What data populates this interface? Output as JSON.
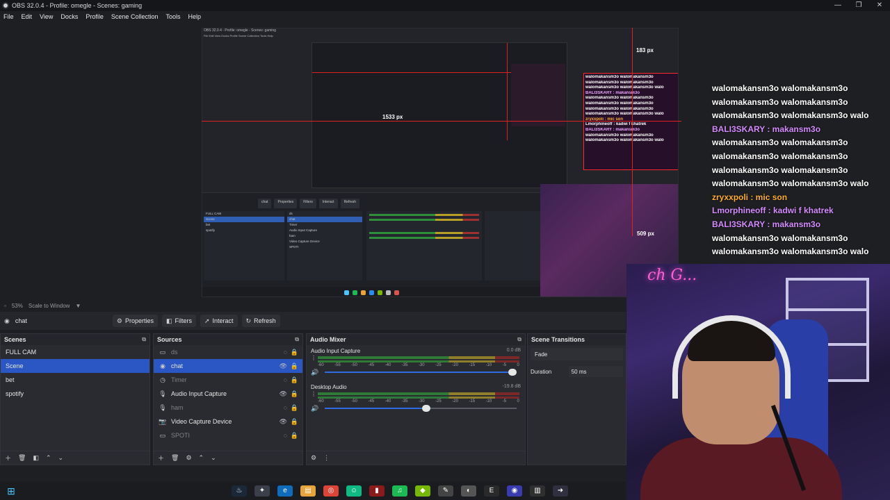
{
  "window": {
    "title": "OBS 32.0.4 - Profile: omegle - Scenes: gaming",
    "controls": [
      "—",
      "❐",
      "✕"
    ]
  },
  "menu": [
    "File",
    "Edit",
    "View",
    "Docks",
    "Profile",
    "Scene Collection",
    "Tools",
    "Help"
  ],
  "preview": {
    "nested_title": "OBS 32.0.4 - Profile: omegle - Scenes: gaming",
    "nested_menu": "File  Edit  View  Docks  Profile  Scene Collection  Tools  Help",
    "px_top": "183 px",
    "px_mid": "1533 px",
    "px_bottom": "509 px",
    "nested_toolbar": [
      "chat",
      "Properties",
      "Filters",
      "Interact",
      "Refresh"
    ],
    "nested_scenes": [
      "FULL CAM",
      "Scene",
      "bet",
      "spotify"
    ],
    "nested_sources": [
      "ds",
      "chat",
      "Timer",
      "Audio Input Capture",
      "ham",
      "Video Capture Device",
      "SPOTI"
    ],
    "nested_chat": [
      {
        "cls": "",
        "t": "walomakansm3o walomakansm3o"
      },
      {
        "cls": "",
        "t": "walomakansm3o walomakansm3o"
      },
      {
        "cls": "",
        "t": "walomakansm3o walomakansm3o walo"
      },
      {
        "cls": "pink",
        "t": "BALI3SKARY : makansm3o"
      },
      {
        "cls": "",
        "t": "walomakansm3o walomakansm3o"
      },
      {
        "cls": "",
        "t": "walomakansm3o walomakansm3o"
      },
      {
        "cls": "",
        "t": "walomakansm3o walomakansm3o"
      },
      {
        "cls": "",
        "t": "walomakansm3o walomakansm3o walo"
      },
      {
        "cls": "ora",
        "t": "zryxxpoli : mic son"
      },
      {
        "cls": "",
        "t": "Lmorphineoff : kadwi f khatrek"
      },
      {
        "cls": "pink",
        "t": "BALI3SKARY : makansm3o"
      },
      {
        "cls": "",
        "t": "walomakansm3o walomakansm3o"
      },
      {
        "cls": "",
        "t": "walomakansm3o walomakansm3o walo"
      }
    ]
  },
  "chat": [
    {
      "cls": "u-white",
      "t": "walomakansm3o walomakansm3o"
    },
    {
      "cls": "u-white",
      "t": "walomakansm3o walomakansm3o"
    },
    {
      "cls": "u-white",
      "t": "walomakansm3o walomakansm3o walo"
    },
    {
      "cls": "u-purple",
      "t": "BALI3SKARY : makansm3o"
    },
    {
      "cls": "u-white",
      "t": "walomakansm3o walomakansm3o"
    },
    {
      "cls": "u-white",
      "t": "walomakansm3o walomakansm3o"
    },
    {
      "cls": "u-white",
      "t": "walomakansm3o walomakansm3o"
    },
    {
      "cls": "u-white",
      "t": "walomakansm3o walomakansm3o walo"
    },
    {
      "cls": "u-orange",
      "t": "zryxxpoli : mic son"
    },
    {
      "cls": "u-purple",
      "t": "Lmorphineoff : kadwi f khatrek"
    },
    {
      "cls": "u-purple",
      "t": "BALI3SKARY : makansm3o"
    },
    {
      "cls": "u-white",
      "t": "walomakansm3o walomakansm3o"
    },
    {
      "cls": "u-white",
      "t": "walomakansm3o walomakansm3o walo"
    }
  ],
  "webcam": {
    "neon": "ch G..."
  },
  "transform_bar": {
    "zoom": "53%",
    "scale_mode": "Scale to Window"
  },
  "source_toolbar": {
    "selected_source": "chat",
    "properties": "Properties",
    "filters": "Filters",
    "interact": "Interact",
    "refresh": "Refresh"
  },
  "scenes": {
    "title": "Scenes",
    "items": [
      "FULL CAM",
      "Scene",
      "bet",
      "spotify"
    ],
    "selected": 1
  },
  "sources": {
    "title": "Sources",
    "items": [
      {
        "icon": "▭",
        "label": "ds",
        "dim": true,
        "eye": "◌",
        "lock": "🔒"
      },
      {
        "icon": "◉",
        "label": "chat",
        "dim": false,
        "eye": "👁",
        "lock": "🔒"
      },
      {
        "icon": "◷",
        "label": "Timer",
        "dim": true,
        "eye": "◌",
        "lock": "🔒"
      },
      {
        "icon": "🎙",
        "label": "Audio Input Capture",
        "dim": false,
        "eye": "👁",
        "lock": "🔒"
      },
      {
        "icon": "🎙",
        "label": "ham",
        "dim": true,
        "eye": "◌",
        "lock": "🔒"
      },
      {
        "icon": "📷",
        "label": "Video Capture Device",
        "dim": false,
        "eye": "👁",
        "lock": "🔒"
      },
      {
        "icon": "▭",
        "label": "SPOTI",
        "dim": true,
        "eye": "◌",
        "lock": "🔒"
      }
    ],
    "selected": 1
  },
  "mixer": {
    "title": "Audio Mixer",
    "scale": [
      "-60",
      "-55",
      "-50",
      "-45",
      "-40",
      "-35",
      "-30",
      "-25",
      "-20",
      "-15",
      "-10",
      "-5",
      "0"
    ],
    "tracks": [
      {
        "name": "Audio Input Capture",
        "db": "0.0 dB",
        "volume": 1.0
      },
      {
        "name": "Desktop Audio",
        "db": "-19.8 dB",
        "volume": 0.55
      }
    ]
  },
  "transitions": {
    "title": "Scene Transitions",
    "type": "Fade",
    "duration_label": "Duration",
    "duration_value": "50 ms"
  },
  "colors": {
    "accent": "#2b57c5",
    "chat_purple": "#d48cff",
    "chat_orange": "#ffae22",
    "guide_red": "#e12020"
  }
}
